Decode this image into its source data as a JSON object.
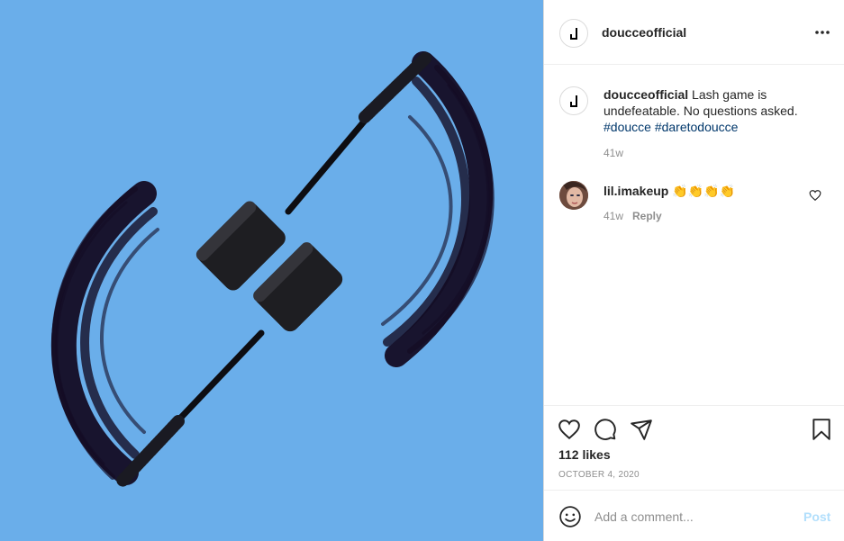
{
  "post": {
    "author": "doucceofficial",
    "image_icon": "mascara-wands-photo"
  },
  "caption": {
    "username": "doucceofficial",
    "text": " Lash game is undefeatable. No questions asked. ",
    "hashtags": [
      "#doucce",
      "#daretodoucce"
    ],
    "time": "41w"
  },
  "comments": [
    {
      "username": "lil.imakeup",
      "text": " 👏👏👏👏",
      "time": "41w",
      "reply_label": "Reply"
    }
  ],
  "actions": {
    "likes": "112 likes",
    "date": "OCTOBER 4, 2020"
  },
  "add_comment": {
    "placeholder": "Add a comment...",
    "post_label": "Post"
  },
  "colors": {
    "photo_background": "#6aaeea",
    "hashtag": "#00376b",
    "post_button_disabled": "#b2dffc"
  }
}
